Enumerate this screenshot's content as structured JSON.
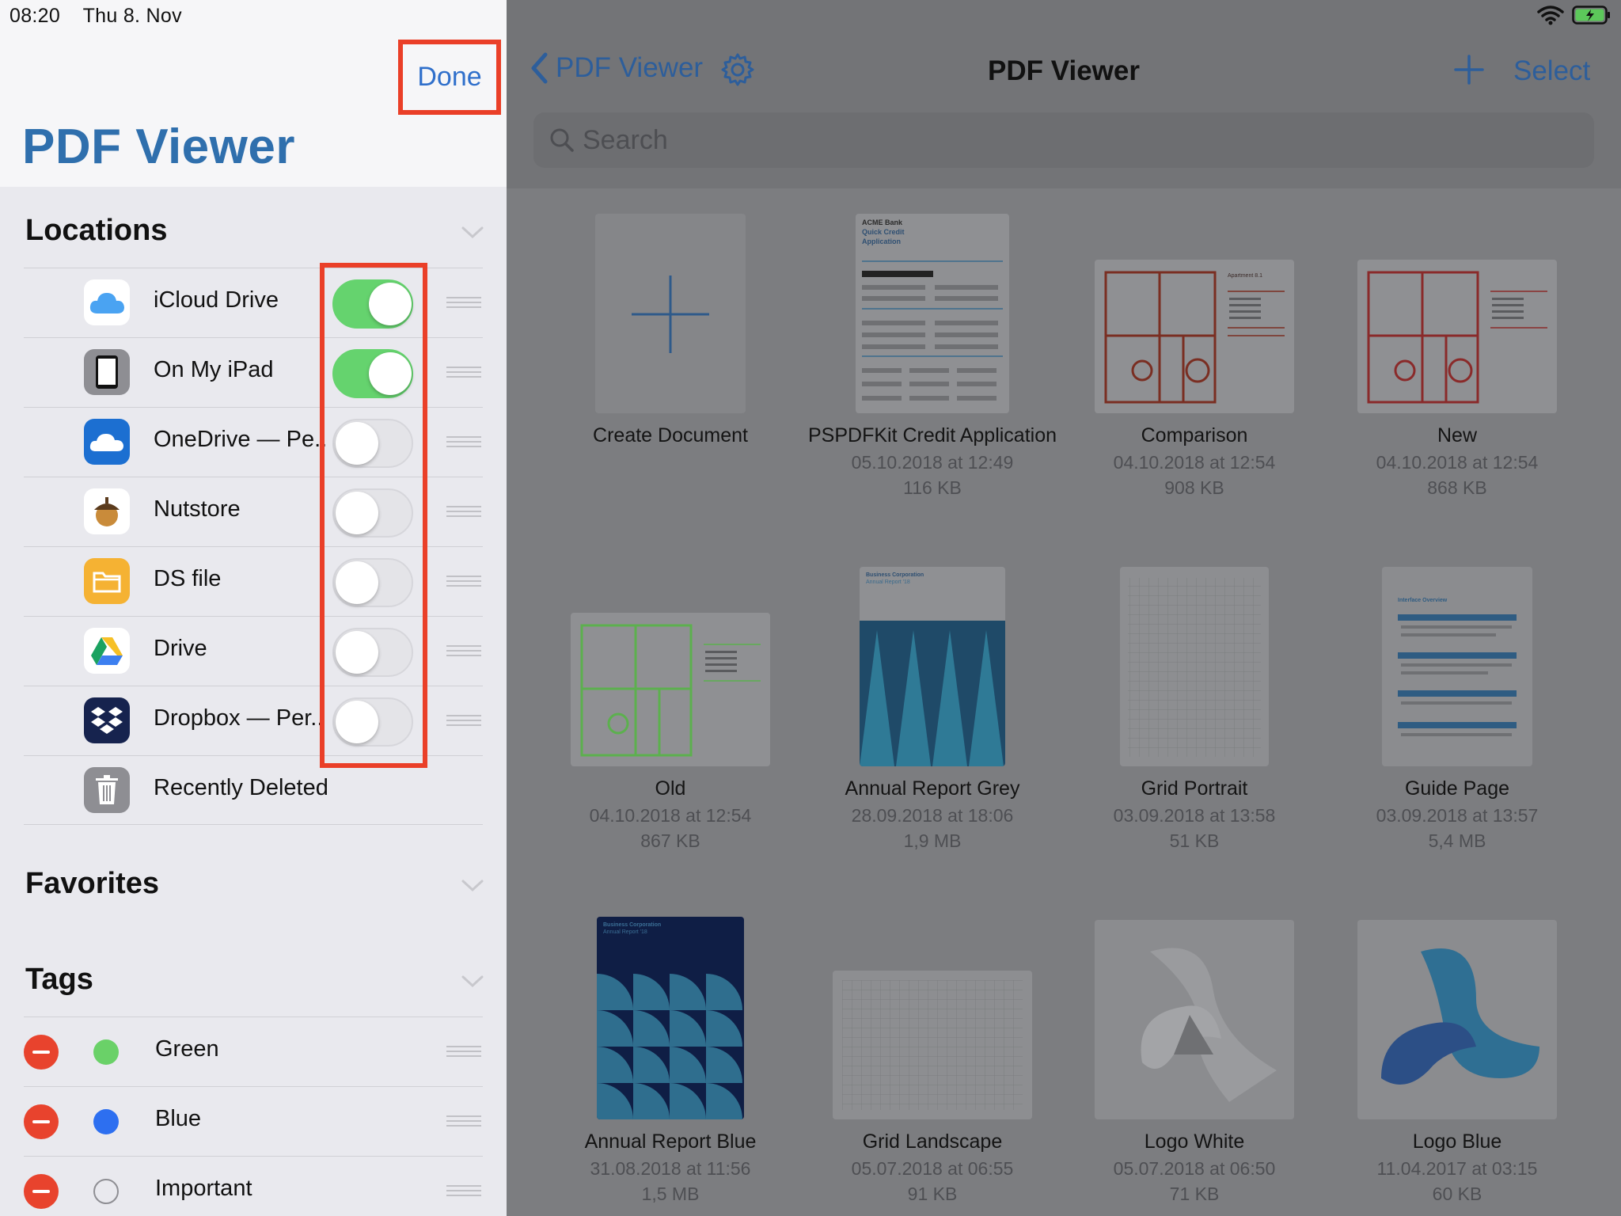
{
  "status": {
    "time": "08:20",
    "date": "Thu 8. Nov"
  },
  "sidebar": {
    "done_label": "Done",
    "title": "PDF Viewer",
    "locations": {
      "title": "Locations",
      "items": [
        {
          "label": "iCloud Drive",
          "enabled": true
        },
        {
          "label": "On My iPad",
          "enabled": true
        },
        {
          "label": "OneDrive — Pe..",
          "enabled": false
        },
        {
          "label": "Nutstore",
          "enabled": false
        },
        {
          "label": "DS file",
          "enabled": false
        },
        {
          "label": "Drive",
          "enabled": false
        },
        {
          "label": "Dropbox — Per..",
          "enabled": false
        },
        {
          "label": "Recently Deleted"
        }
      ]
    },
    "favorites": {
      "title": "Favorites"
    },
    "tags": {
      "title": "Tags",
      "items": [
        {
          "label": "Green",
          "color": "#6ad168"
        },
        {
          "label": "Blue",
          "color": "#2d6ff0"
        },
        {
          "label": "Important",
          "color": ""
        }
      ]
    }
  },
  "nav": {
    "back_label": "PDF Viewer",
    "title": "PDF Viewer",
    "select_label": "Select",
    "search_placeholder": "Search"
  },
  "documents": [
    {
      "name": "Create Document",
      "date": "",
      "size": ""
    },
    {
      "name": "PSPDFKit Credit Application",
      "date": "05.10.2018 at 12:49",
      "size": "116 KB"
    },
    {
      "name": "Comparison",
      "date": "04.10.2018 at 12:54",
      "size": "908 KB"
    },
    {
      "name": "New",
      "date": "04.10.2018 at 12:54",
      "size": "868 KB"
    },
    {
      "name": "Old",
      "date": "04.10.2018 at 12:54",
      "size": "867 KB"
    },
    {
      "name": "Annual Report Grey",
      "date": "28.09.2018 at 18:06",
      "size": "1,9 MB"
    },
    {
      "name": "Grid Portrait",
      "date": "03.09.2018 at 13:58",
      "size": "51 KB"
    },
    {
      "name": "Guide Page",
      "date": "03.09.2018 at 13:57",
      "size": "5,4 MB"
    },
    {
      "name": "Annual Report Blue",
      "date": "31.08.2018 at 11:56",
      "size": "1,5 MB"
    },
    {
      "name": "Grid Landscape",
      "date": "05.07.2018 at 06:55",
      "size": "91 KB"
    },
    {
      "name": "Logo White",
      "date": "05.07.2018 at 06:50",
      "size": "71 KB"
    },
    {
      "name": "Logo Blue",
      "date": "11.04.2017 at 03:15",
      "size": "60 KB"
    }
  ],
  "thumb_texts": {
    "acme": "ACME Bank",
    "quick_credit": "Quick Credit",
    "application": "Application",
    "business_corp": "Business Corporation",
    "annual_report": "Annual Report '18",
    "apartment": "Apartment 8.1",
    "interface_overview": "Interface Overview"
  }
}
